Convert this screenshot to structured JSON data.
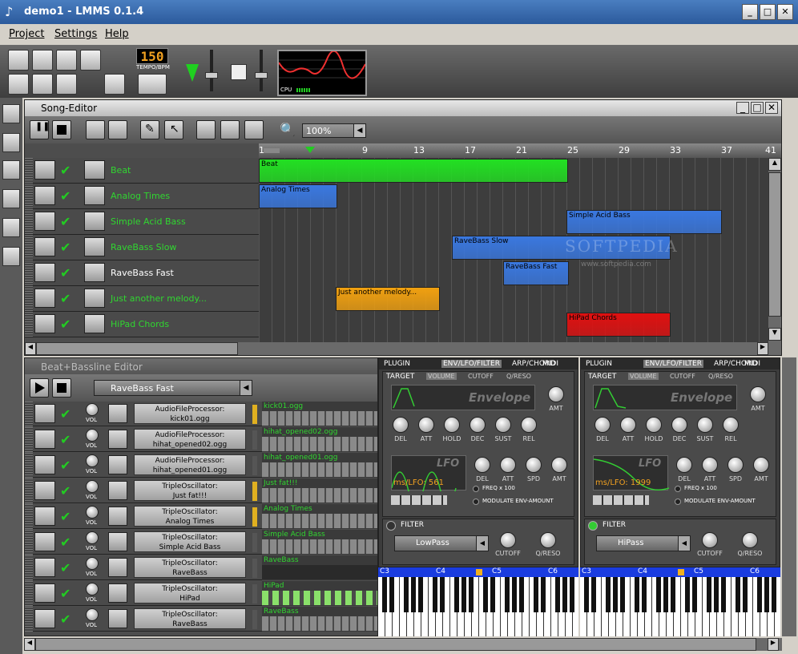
{
  "window": {
    "title": "demo1 - LMMS 0.1.4"
  },
  "menu": [
    "Project",
    "Settings",
    "Help"
  ],
  "toolbar": {
    "tempo": "150",
    "tempo_label": "TEMPO/BPM",
    "cpu_label": "CPU"
  },
  "song_editor": {
    "title": "Song-Editor",
    "zoom": "100%",
    "ruler": [
      "1",
      "9",
      "13",
      "17",
      "21",
      "25",
      "29",
      "33",
      "37",
      "41"
    ],
    "tracks": [
      {
        "name": "Beat",
        "highlight": true
      },
      {
        "name": "Analog Times",
        "highlight": true
      },
      {
        "name": "Simple Acid Bass",
        "highlight": true
      },
      {
        "name": "RaveBass Slow",
        "highlight": true
      },
      {
        "name": "RaveBass Fast",
        "highlight": false
      },
      {
        "name": "Just another melody...",
        "highlight": true
      },
      {
        "name": "HiPad Chords",
        "highlight": true
      }
    ],
    "segments": [
      {
        "label": "Beat",
        "color": "#22e022"
      },
      {
        "label": "Analog Times",
        "color": "#3a78e0"
      },
      {
        "label": "Simple Acid Bass",
        "color": "#3a78e0"
      },
      {
        "label": "RaveBass Slow",
        "color": "#3a78e0"
      },
      {
        "label": "RaveBass Fast",
        "color": "#3a78e0"
      },
      {
        "label": "Just another melody...",
        "color": "#f0a010"
      },
      {
        "label": "HiPad Chords",
        "color": "#e01010"
      }
    ],
    "watermark": "SOFTPEDIA",
    "watermark_url": "www.softpedia.com"
  },
  "bb_editor": {
    "title": "Beat+Bassline Editor",
    "selected": "RaveBass Fast",
    "vol_label": "VOL",
    "rows": [
      {
        "plugin": "AudioFileProcessor:",
        "name": "kick01.ogg",
        "pattern": "kick01.ogg"
      },
      {
        "plugin": "AudioFileProcessor:",
        "name": "hihat_opened02.ogg",
        "pattern": "hihat_opened02.ogg"
      },
      {
        "plugin": "AudioFileProcessor:",
        "name": "hihat_opened01.ogg",
        "pattern": "hihat_opened01.ogg"
      },
      {
        "plugin": "TripleOscillator:",
        "name": "Just fat!!!",
        "pattern": "Just fat!!!"
      },
      {
        "plugin": "TripleOscillator:",
        "name": "Analog Times",
        "pattern": "Analog Times"
      },
      {
        "plugin": "TripleOscillator:",
        "name": "Simple Acid Bass",
        "pattern": "Simple Acid Bass"
      },
      {
        "plugin": "TripleOscillator:",
        "name": "RaveBass",
        "pattern": "RaveBass"
      },
      {
        "plugin": "TripleOscillator:",
        "name": "HiPad",
        "pattern": "HiPad"
      },
      {
        "plugin": "TripleOscillator:",
        "name": "RaveBass",
        "pattern": "RaveBass"
      }
    ]
  },
  "instruments": [
    {
      "tabs": [
        "PLUGIN",
        "ENV/LFO/FILTER",
        "ARP/CHORD",
        "MIDI"
      ],
      "target": "TARGET",
      "subtabs": [
        "VOLUME",
        "CUTOFF",
        "Q/RESO"
      ],
      "envelope": "Envelope",
      "amt": "AMT",
      "env_knobs": [
        "DEL",
        "ATT",
        "HOLD",
        "DEC",
        "SUST",
        "REL"
      ],
      "lfo": "LFO",
      "lfo_value": "ms/LFO: 561",
      "lfo_knobs": [
        "DEL",
        "ATT",
        "SPD",
        "AMT"
      ],
      "freq": "FREQ x 100",
      "modulate": "MODULATE ENV-AMOUNT",
      "filter": "FILTER",
      "filter_type": "LowPass",
      "filter_knobs": [
        "CUTOFF",
        "Q/RESO"
      ],
      "keys": [
        "C3",
        "C4",
        "C5",
        "C6"
      ]
    },
    {
      "tabs": [
        "PLUGIN",
        "ENV/LFO/FILTER",
        "ARP/CHORD",
        "MIDI"
      ],
      "target": "TARGET",
      "subtabs": [
        "VOLUME",
        "CUTOFF",
        "Q/RESO"
      ],
      "envelope": "Envelope",
      "amt": "AMT",
      "env_knobs": [
        "DEL",
        "ATT",
        "HOLD",
        "DEC",
        "SUST",
        "REL"
      ],
      "lfo": "LFO",
      "lfo_value": "ms/LFO: 1999",
      "lfo_knobs": [
        "DEL",
        "ATT",
        "SPD",
        "AMT"
      ],
      "freq": "FREQ x 100",
      "modulate": "MODULATE ENV-AMOUNT",
      "filter": "FILTER",
      "filter_type": "HiPass",
      "filter_knobs": [
        "CUTOFF",
        "Q/RESO"
      ],
      "keys": [
        "C3",
        "C4",
        "C5",
        "C6"
      ]
    }
  ]
}
